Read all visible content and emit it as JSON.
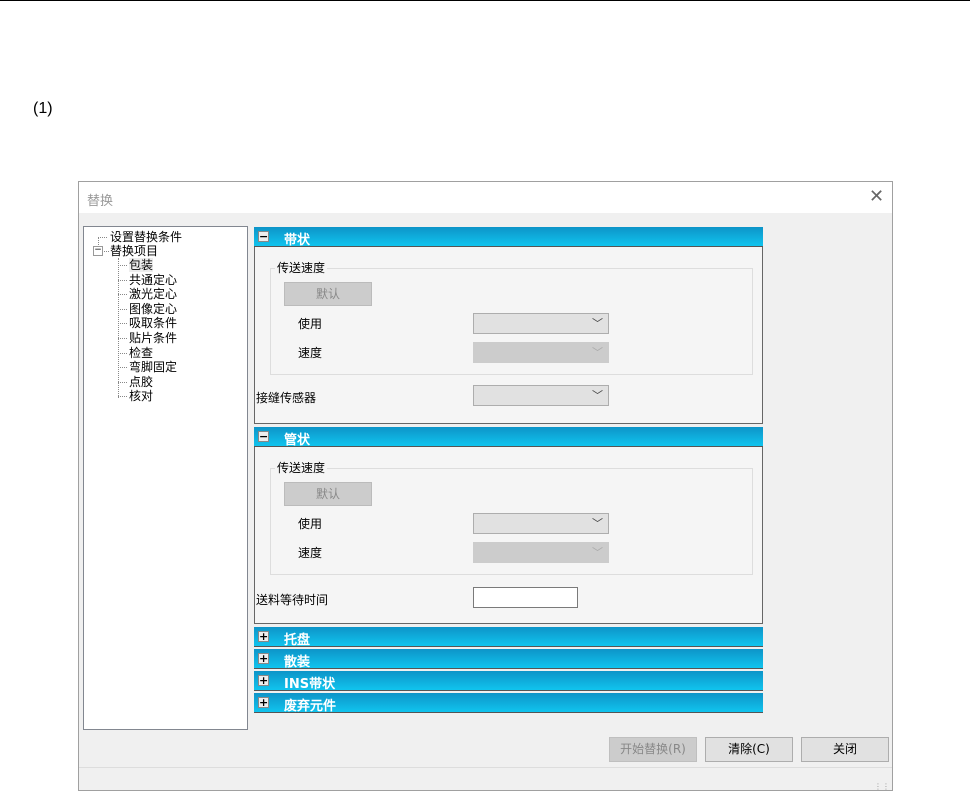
{
  "page_label": "(1)",
  "dialog": {
    "title": "替换",
    "close_glyph": "✕",
    "tree": {
      "root_items": [
        {
          "label": "设置替换条件"
        },
        {
          "label": "替换项目",
          "expanded": true
        }
      ],
      "children": [
        "包装",
        "共通定心",
        "激光定心",
        "图像定心",
        "吸取条件",
        "贴片条件",
        "检查",
        "弯脚固定",
        "点胶",
        "核对"
      ],
      "selected": "包装"
    },
    "sections": [
      {
        "title": "带状",
        "expanded": true,
        "toggle": "−",
        "group_label": "传送速度",
        "default_button": "默认",
        "use_label": "使用",
        "speed_label": "速度",
        "extra_label": "接缝传感器"
      },
      {
        "title": "管状",
        "expanded": true,
        "toggle": "−",
        "group_label": "传送速度",
        "default_button": "默认",
        "use_label": "使用",
        "speed_label": "速度",
        "extra_label": "送料等待时间",
        "extra_value": ""
      },
      {
        "title": "托盘",
        "expanded": false,
        "toggle": "+"
      },
      {
        "title": "散装",
        "expanded": false,
        "toggle": "+"
      },
      {
        "title": "INS带状",
        "expanded": false,
        "toggle": "+"
      },
      {
        "title": "废弃元件",
        "expanded": false,
        "toggle": "+"
      }
    ],
    "buttons": {
      "start": "开始替换(R)",
      "clear": "清除(C)",
      "close": "关闭"
    },
    "chevron": "﹀"
  }
}
